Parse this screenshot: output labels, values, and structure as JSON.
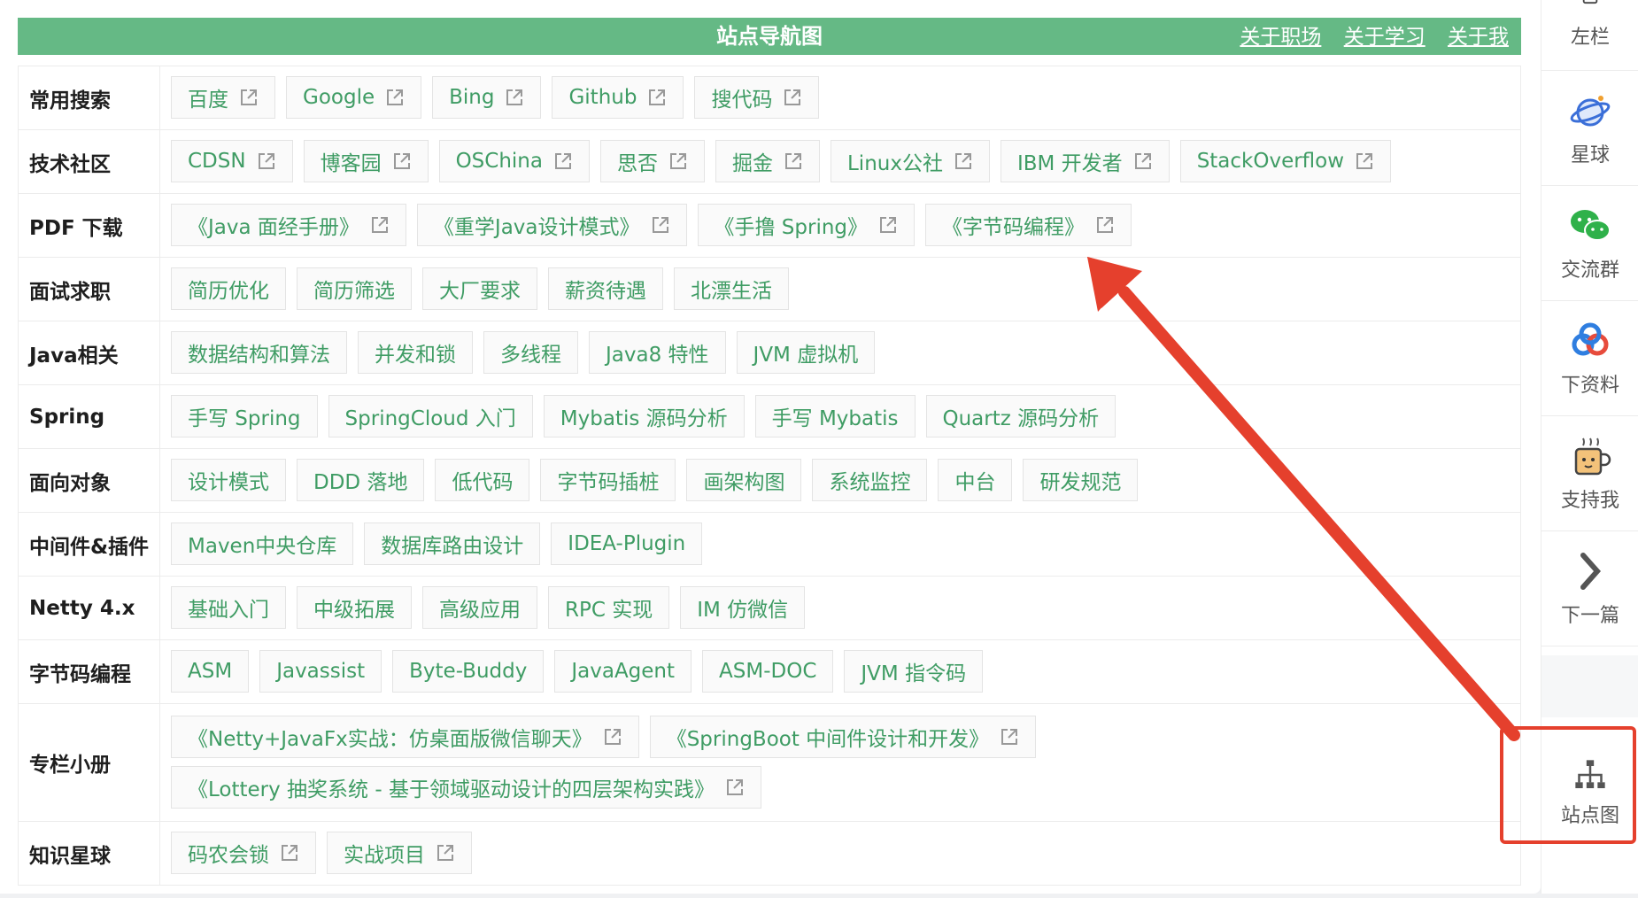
{
  "header": {
    "title": "站点导航图",
    "links": [
      "关于职场",
      "关于学习",
      "关于我"
    ]
  },
  "rows": [
    {
      "label": "常用搜索",
      "links": [
        {
          "text": "百度",
          "external": true
        },
        {
          "text": "Google",
          "external": true
        },
        {
          "text": "Bing",
          "external": true
        },
        {
          "text": "Github",
          "external": true
        },
        {
          "text": "搜代码",
          "external": true
        }
      ]
    },
    {
      "label": "技术社区",
      "links": [
        {
          "text": "CDSN",
          "external": true
        },
        {
          "text": "博客园",
          "external": true
        },
        {
          "text": "OSChina",
          "external": true
        },
        {
          "text": "思否",
          "external": true
        },
        {
          "text": "掘金",
          "external": true
        },
        {
          "text": "Linux公社",
          "external": true
        },
        {
          "text": "IBM 开发者",
          "external": true
        },
        {
          "text": "StackOverflow",
          "external": true
        }
      ]
    },
    {
      "label": "PDF 下载",
      "links": [
        {
          "text": "《Java 面经手册》",
          "external": true
        },
        {
          "text": "《重学Java设计模式》",
          "external": true
        },
        {
          "text": "《手撸 Spring》",
          "external": true
        },
        {
          "text": "《字节码编程》",
          "external": true
        }
      ]
    },
    {
      "label": "面试求职",
      "links": [
        {
          "text": "简历优化",
          "external": false
        },
        {
          "text": "简历筛选",
          "external": false
        },
        {
          "text": "大厂要求",
          "external": false
        },
        {
          "text": "薪资待遇",
          "external": false
        },
        {
          "text": "北漂生活",
          "external": false
        }
      ]
    },
    {
      "label": "Java相关",
      "links": [
        {
          "text": "数据结构和算法",
          "external": false
        },
        {
          "text": "并发和锁",
          "external": false
        },
        {
          "text": "多线程",
          "external": false
        },
        {
          "text": "Java8 特性",
          "external": false
        },
        {
          "text": "JVM 虚拟机",
          "external": false
        }
      ]
    },
    {
      "label": "Spring",
      "links": [
        {
          "text": "手写 Spring",
          "external": false
        },
        {
          "text": "SpringCloud 入门",
          "external": false
        },
        {
          "text": "Mybatis 源码分析",
          "external": false
        },
        {
          "text": "手写 Mybatis",
          "external": false
        },
        {
          "text": "Quartz 源码分析",
          "external": false
        }
      ]
    },
    {
      "label": "面向对象",
      "links": [
        {
          "text": "设计模式",
          "external": false
        },
        {
          "text": "DDD 落地",
          "external": false
        },
        {
          "text": "低代码",
          "external": false
        },
        {
          "text": "字节码插桩",
          "external": false
        },
        {
          "text": "画架构图",
          "external": false
        },
        {
          "text": "系统监控",
          "external": false
        },
        {
          "text": "中台",
          "external": false
        },
        {
          "text": "研发规范",
          "external": false
        }
      ]
    },
    {
      "label": "中间件&插件",
      "links": [
        {
          "text": "Maven中央仓库",
          "external": false
        },
        {
          "text": "数据库路由设计",
          "external": false
        },
        {
          "text": "IDEA-Plugin",
          "external": false
        }
      ]
    },
    {
      "label": "Netty 4.x",
      "links": [
        {
          "text": "基础入门",
          "external": false
        },
        {
          "text": "中级拓展",
          "external": false
        },
        {
          "text": "高级应用",
          "external": false
        },
        {
          "text": "RPC 实现",
          "external": false
        },
        {
          "text": "IM 仿微信",
          "external": false
        }
      ]
    },
    {
      "label": "字节码编程",
      "links": [
        {
          "text": "ASM",
          "external": false
        },
        {
          "text": "Javassist",
          "external": false
        },
        {
          "text": "Byte-Buddy",
          "external": false
        },
        {
          "text": "JavaAgent",
          "external": false
        },
        {
          "text": "ASM-DOC",
          "external": false
        },
        {
          "text": "JVM 指令码",
          "external": false
        }
      ]
    },
    {
      "label": "专栏小册",
      "links": [
        {
          "text": "《Netty+JavaFx实战：仿桌面版微信聊天》",
          "external": true
        },
        {
          "text": "《SpringBoot 中间件设计和开发》",
          "external": true
        },
        {
          "text": "《Lottery 抽奖系统 - 基于领域驱动设计的四层架构实践》",
          "external": true
        }
      ]
    },
    {
      "label": "知识星球",
      "links": [
        {
          "text": "码农会锁",
          "external": true
        },
        {
          "text": "实战项目",
          "external": true
        }
      ]
    }
  ],
  "sidebar": [
    {
      "label": "左栏",
      "icon": "sidebar-icon"
    },
    {
      "label": "星球",
      "icon": "planet-icon"
    },
    {
      "label": "交流群",
      "icon": "wechat-icon"
    },
    {
      "label": "下资料",
      "icon": "baidu-cloud-icon"
    },
    {
      "label": "支持我",
      "icon": "coffee-cup-icon"
    },
    {
      "label": "下一篇",
      "icon": "chevron-right-icon"
    },
    {
      "label": "站点图",
      "icon": "sitemap-icon"
    }
  ],
  "colors": {
    "header_bg": "#65b985",
    "link_green": "#3f9c64",
    "annotation_red": "#e5402d"
  }
}
